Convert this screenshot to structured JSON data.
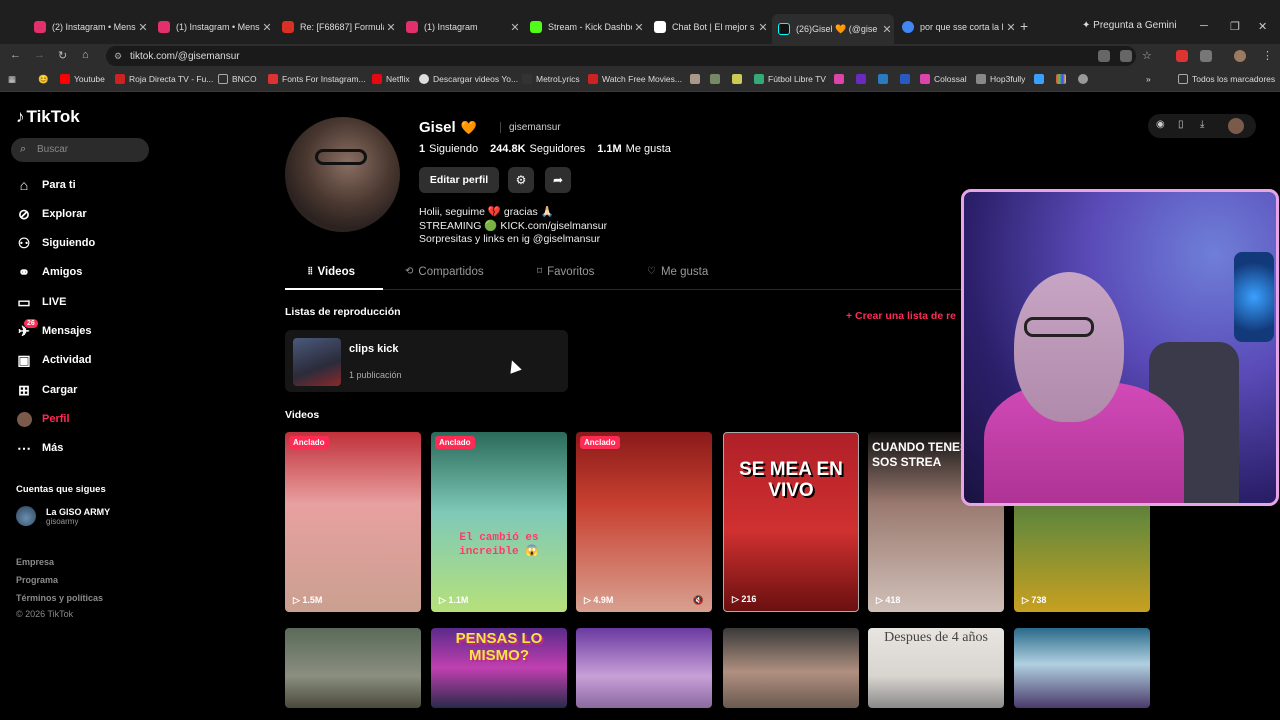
{
  "browser": {
    "tabs": [
      {
        "title": "(2) Instagram • Mens",
        "color": "#e1306c"
      },
      {
        "title": "(1) Instagram • Mens",
        "color": "#e1306c"
      },
      {
        "title": "Re: [F68687] Formula",
        "color": "#d93025"
      },
      {
        "title": "(1) Instagram",
        "color": "#e1306c"
      },
      {
        "title": "Stream - Kick Dashbo",
        "color": "#53fc18"
      },
      {
        "title": "Chat Bot | El mejor s",
        "color": "#ffffff"
      },
      {
        "title": "(26)Gisel 🧡 (@gise",
        "color": "#ffffff"
      },
      {
        "title": "por que sse corta la l",
        "color": "#4285f4"
      }
    ],
    "new_tab": "+",
    "gemini": "Pregunta a Gemini",
    "url": "tiktok.com/@gisemansur",
    "bookmarks": [
      {
        "label": "Youtube",
        "color": "#ff0000"
      },
      {
        "label": "Roja Directa TV - Fu...",
        "color": "#c22"
      },
      {
        "label": "BNCO",
        "color": "#888"
      },
      {
        "label": "Fonts For Instagram...",
        "color": "#d33"
      },
      {
        "label": "Netflix",
        "color": "#e50914"
      },
      {
        "label": "Descargar videos Yo...",
        "color": "#ddd"
      },
      {
        "label": "MetroLyrics",
        "color": "#333"
      },
      {
        "label": "Watch Free Movies...",
        "color": "#c22"
      },
      {
        "label": "Fútbol Libre TV",
        "color": "#3a7"
      },
      {
        "label": "Colossal",
        "color": "#d4a"
      },
      {
        "label": "Hop3fully",
        "color": "#888"
      }
    ],
    "all_bookmarks": "Todos los marcadores"
  },
  "sidebar": {
    "logo": "TikTok",
    "search_placeholder": "Buscar",
    "items": [
      {
        "label": "Para ti",
        "icon": "home-icon"
      },
      {
        "label": "Explorar",
        "icon": "compass-icon"
      },
      {
        "label": "Siguiendo",
        "icon": "following-icon"
      },
      {
        "label": "Amigos",
        "icon": "friends-icon"
      },
      {
        "label": "LIVE",
        "icon": "live-icon"
      },
      {
        "label": "Mensajes",
        "icon": "messages-icon",
        "badge": "26"
      },
      {
        "label": "Actividad",
        "icon": "activity-icon"
      },
      {
        "label": "Cargar",
        "icon": "upload-icon"
      },
      {
        "label": "Perfil",
        "icon": "profile-icon"
      },
      {
        "label": "Más",
        "icon": "more-icon"
      }
    ],
    "following_heading": "Cuentas que sigues",
    "following": {
      "name": "La GISO ARMY",
      "handle": "gisoarmy"
    },
    "footer": [
      "Empresa",
      "Programa",
      "Términos y políticas",
      "© 2026 TikTok"
    ]
  },
  "profile": {
    "name": "Gisel",
    "handle": "gisemansur",
    "following_count": "1",
    "following_label": "Siguiendo",
    "followers_count": "244.8K",
    "followers_label": "Seguidores",
    "likes_count": "1.1M",
    "likes_label": "Me gusta",
    "edit_button": "Editar perfil",
    "bio": [
      "Holii, seguime 💔 gracias 🙏🏻",
      "STREAMING 🟢 KICK.com/giselmansur",
      "Sorpresitas y links en ig @giselmansur"
    ]
  },
  "tabs": [
    {
      "label": "Videos",
      "icon": "≡"
    },
    {
      "label": "Compartidos",
      "icon": "⟲"
    },
    {
      "label": "Favoritos",
      "icon": "⌑"
    },
    {
      "label": "Me gusta",
      "icon": "♡"
    }
  ],
  "playlists": {
    "heading": "Listas de reproducción",
    "create": "+ Crear una lista de re",
    "item": {
      "title": "clips kick",
      "subtitle": "1 publicación"
    }
  },
  "videos_heading": "Videos",
  "videos": [
    {
      "pinned": "Anclado",
      "views": "1.5M",
      "bg": "linear-gradient(180deg,#c0303a,#e8a0a0 40%,#caa090)"
    },
    {
      "pinned": "Anclado",
      "views": "1.1M",
      "bg": "linear-gradient(180deg,#2a6a5a,#7fc9b8 45%,#b6e07a)",
      "caption": "El cambió es increible 😱"
    },
    {
      "pinned": "Anclado",
      "views": "4.9M",
      "bg": "linear-gradient(180deg,#8a1a1a,#c84030 40%,#d8a090)"
    },
    {
      "views": "216",
      "bg": "linear-gradient(180deg,#b02028,#d03030 55%,#6a1010)",
      "caption": "SE MEA EN VIVO"
    },
    {
      "views": "418",
      "bg": "linear-gradient(180deg,#111,#9a7a70 40%,#d0c0b8)",
      "caption": "CUANDO TENES D Y SOS STREA"
    },
    {
      "views": "738",
      "bg": "linear-gradient(180deg,#3a4a2a,#6a8a3a 50%,#c8a020)"
    },
    {
      "bg": "linear-gradient(180deg,#5a6a5a,#8a8f80 60%,#4a4a3a)"
    },
    {
      "bg": "linear-gradient(180deg,#5a2a8a,#c040b0 50%,#2a2a4a)",
      "caption": "PENSAS LO MISMO?"
    },
    {
      "bg": "linear-gradient(180deg,#6a3aa0,#c8a0d8 60%,#8a6aa0)"
    },
    {
      "bg": "linear-gradient(180deg,#3a3a3a,#b09080 55%,#6a5a50)"
    },
    {
      "bg": "linear-gradient(180deg,#e8e4e0,#d8d4d0 60%,#8a8a8a)",
      "caption": "Despues de 4 años"
    },
    {
      "bg": "linear-gradient(180deg,#2a6a8a,#b0d0e0 45%,#4a3a6a)"
    }
  ]
}
